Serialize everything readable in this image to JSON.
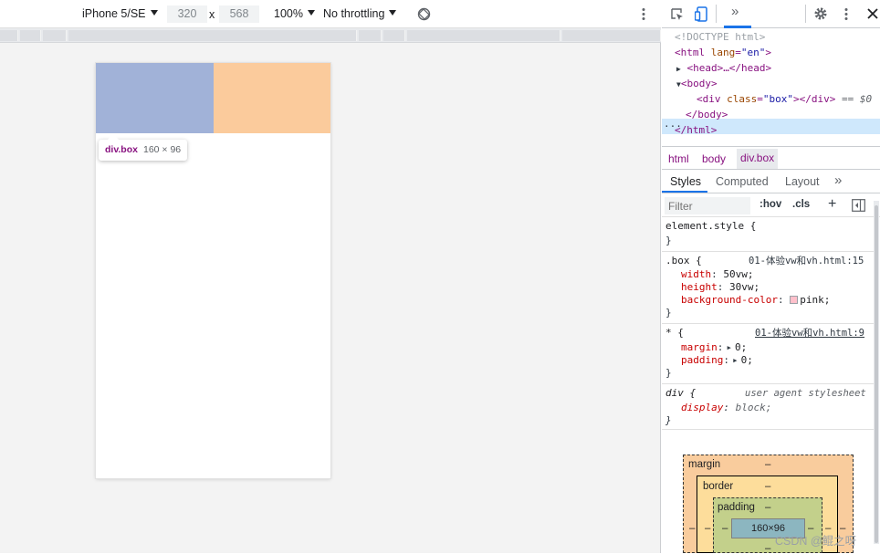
{
  "device_toolbar": {
    "device_name": "iPhone 5/SE",
    "width": "320",
    "times": "x",
    "height": "568",
    "zoom": "100%",
    "throttling": "No throttling",
    "rotate_icon": "rotate-icon",
    "more_icon": "more-vert-icon"
  },
  "page_overlay": {
    "box_color": "#a1b2d8",
    "margin_highlight_color": "#fbcb9c",
    "tooltip_selector": "div.box",
    "tooltip_size": "160 × 96"
  },
  "devtools_toolbar": {
    "inspect_icon": "inspect-element-icon",
    "device_icon": "device-toggle-icon",
    "overflow": "»",
    "settings_icon": "gear-icon",
    "kebab_icon": "more-vert-icon",
    "close_icon": "close-icon"
  },
  "elements_tree": {
    "doctype": "<!DOCTYPE html>",
    "html_open_tag": "<html",
    "html_lang_attr": "lang",
    "html_lang_value": "\"en\"",
    "html_open_close": ">",
    "head": "<head>…</head>",
    "body_open": "<body>",
    "dots": "···",
    "div_open": "<div",
    "div_class_attr": "class",
    "div_class_value": "\"box\"",
    "div_close": "></div>",
    "selected_suffix": "== $0",
    "body_close": "</body>",
    "html_close": "</html>"
  },
  "breadcrumbs": [
    "html",
    "body",
    "div.box"
  ],
  "sub_tabs": [
    "Styles",
    "Computed",
    "Layout",
    "»"
  ],
  "filter": {
    "placeholder": "Filter",
    "hov": ":hov",
    "cls": ".cls",
    "plus": "+"
  },
  "styles": {
    "element_style": {
      "selector": "element.style {",
      "close": "}"
    },
    "box_rule": {
      "selector": ".box {",
      "source": "01-体验vw和vh.html:15",
      "props": [
        {
          "name": "width",
          "value": "50vw;"
        },
        {
          "name": "height",
          "value": "30vw;"
        },
        {
          "name": "background-color",
          "value": "pink;"
        }
      ],
      "swatch_color": "#ffc0cb",
      "close": "}"
    },
    "star_rule": {
      "selector": "* {",
      "source": "01-体验vw和vh.html:9",
      "props": [
        {
          "name": "margin",
          "value": "0;"
        },
        {
          "name": "padding",
          "value": "0;"
        }
      ],
      "close": "}"
    },
    "ua_rule": {
      "selector": "div {",
      "source": "user agent stylesheet",
      "props": [
        {
          "name": "display",
          "value": "block;"
        }
      ],
      "close": "}"
    }
  },
  "box_model": {
    "margin_label": "margin",
    "border_label": "border",
    "padding_label": "padding",
    "dash": "–",
    "content": "160×96"
  },
  "watermark": "CSDN @鲲之呀"
}
